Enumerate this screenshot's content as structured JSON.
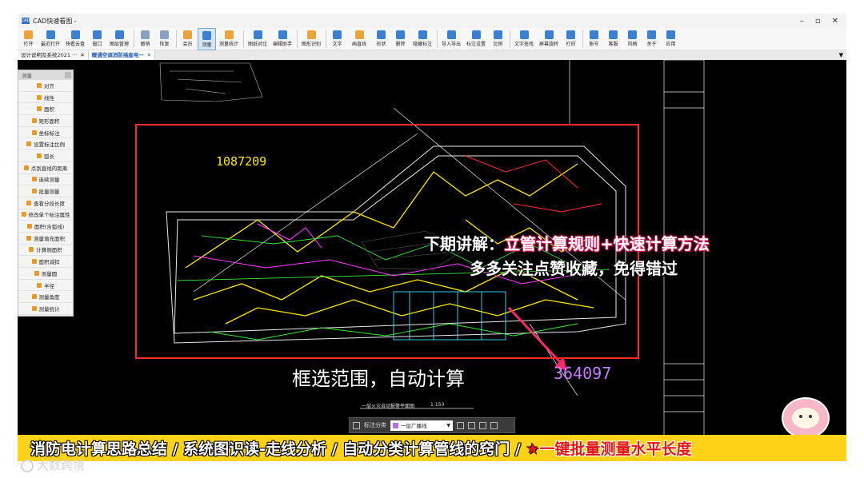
{
  "window": {
    "title": "CAD快速看图 -",
    "app_icon_text": "CAD",
    "controls": [
      "–",
      "▫",
      "✕"
    ]
  },
  "toolbar": {
    "buttons": [
      {
        "label": "打开",
        "icon": "folder-open-icon",
        "color": "#e9a53a"
      },
      {
        "label": "最近打开",
        "icon": "recent-icon",
        "color": "#3a7fd0"
      },
      {
        "label": "快看云盘",
        "icon": "cloud-icon",
        "color": "#3a7fd0"
      },
      {
        "label": "窗口",
        "icon": "window-icon",
        "color": "#3a7fd0"
      },
      {
        "label": "图层管理",
        "icon": "layers-icon",
        "color": "#3a7fd0"
      },
      {
        "label": "撤销",
        "icon": "undo-icon",
        "color": "#8aa0c0"
      },
      {
        "label": "恢复",
        "icon": "redo-icon",
        "color": "#8aa0c0"
      },
      {
        "label": "会员",
        "icon": "vip-icon",
        "color": "#e9a53a"
      },
      {
        "label": "测量",
        "icon": "measure-icon",
        "color": "#3a7fd0"
      },
      {
        "label": "测量统计",
        "icon": "measure-stats-icon",
        "color": "#e9a53a"
      },
      {
        "label": "图纸对比",
        "icon": "compare-icon",
        "color": "#3a7fd0"
      },
      {
        "label": "编辑助手",
        "icon": "edit-assistant-icon",
        "color": "#3a7fd0"
      },
      {
        "label": "图形识别",
        "icon": "shape-recognize-icon",
        "color": "#e9a53a"
      },
      {
        "label": "文字",
        "icon": "text-icon",
        "color": "#3a7fd0"
      },
      {
        "label": "画直线",
        "icon": "line-icon",
        "color": "#e9a53a"
      },
      {
        "label": "形状",
        "icon": "shape-icon",
        "color": "#3a7fd0"
      },
      {
        "label": "删除",
        "icon": "eraser-icon",
        "color": "#3a7fd0"
      },
      {
        "label": "隐藏标注",
        "icon": "hide-annotation-icon",
        "color": "#3a7fd0"
      },
      {
        "label": "导入导出",
        "icon": "import-export-icon",
        "color": "#3a7fd0"
      },
      {
        "label": "标注设置",
        "icon": "annotation-settings-icon",
        "color": "#3a7fd0"
      },
      {
        "label": "比例",
        "icon": "scale-icon",
        "color": "#3a7fd0"
      },
      {
        "label": "文字查找",
        "icon": "text-search-icon",
        "color": "#3a7fd0"
      },
      {
        "label": "屏幕旋转",
        "icon": "rotate-screen-icon",
        "color": "#3a7fd0"
      },
      {
        "label": "打印",
        "icon": "print-icon",
        "color": "#3a7fd0"
      },
      {
        "label": "账号",
        "icon": "account-icon",
        "color": "#3a7fd0"
      },
      {
        "label": "客服",
        "icon": "headset-icon",
        "color": "#3a7fd0"
      },
      {
        "label": "风格",
        "icon": "style-icon",
        "color": "#3a7fd0"
      },
      {
        "label": "关于",
        "icon": "info-icon",
        "color": "#3a7fd0"
      },
      {
        "label": "应用",
        "icon": "apps-icon",
        "color": "#3a7fd0"
      }
    ],
    "active_index": 8
  },
  "tabs": [
    {
      "label": "设计说明及系统2021 ···",
      "close": "✕",
      "active": false
    },
    {
      "label": "暖通空调消防插座电一",
      "close": "✕",
      "active": true
    }
  ],
  "tabs_menu": "▼",
  "palette": {
    "title": "测量",
    "items": [
      "对齐",
      "线性",
      "面积",
      "矩形面积",
      "坐标标注",
      "设置标注比例",
      "弧长",
      "点到直线的距离",
      "连续测量",
      "批量测量",
      "查看分段长度",
      "修改单个标注属性",
      "面积(含弧线)",
      "测量填充面积",
      "计算侧面积",
      "面积减扣",
      "测量圆",
      "半径",
      "测量角度",
      "测量统计"
    ]
  },
  "canvas": {
    "number_top": "1087209",
    "number_bottom": "364097",
    "caption_next_prefix": "下期讲解：",
    "caption_next_highlight": "立管计算规则+快速计算方法",
    "caption_follow": "多多关注点赞收藏，免得错过",
    "caption_box_select": "框选范围，自动计算",
    "plan_title": "一层火灾自动报警平面图",
    "plan_scale": "1:150"
  },
  "float_bar": {
    "label": "标注分类",
    "selected": "一层广播线",
    "swatch_color": "#b070e0",
    "caret": "▼"
  },
  "banner": {
    "text": "消防电计算思路总结 / 系统图识读-走线分析 / 自动分类计算管线的窍门 / ",
    "star": "★",
    "tail": "一键批量测量水平长度",
    "color": "#ffd21a"
  },
  "watermark": "大数跨境"
}
